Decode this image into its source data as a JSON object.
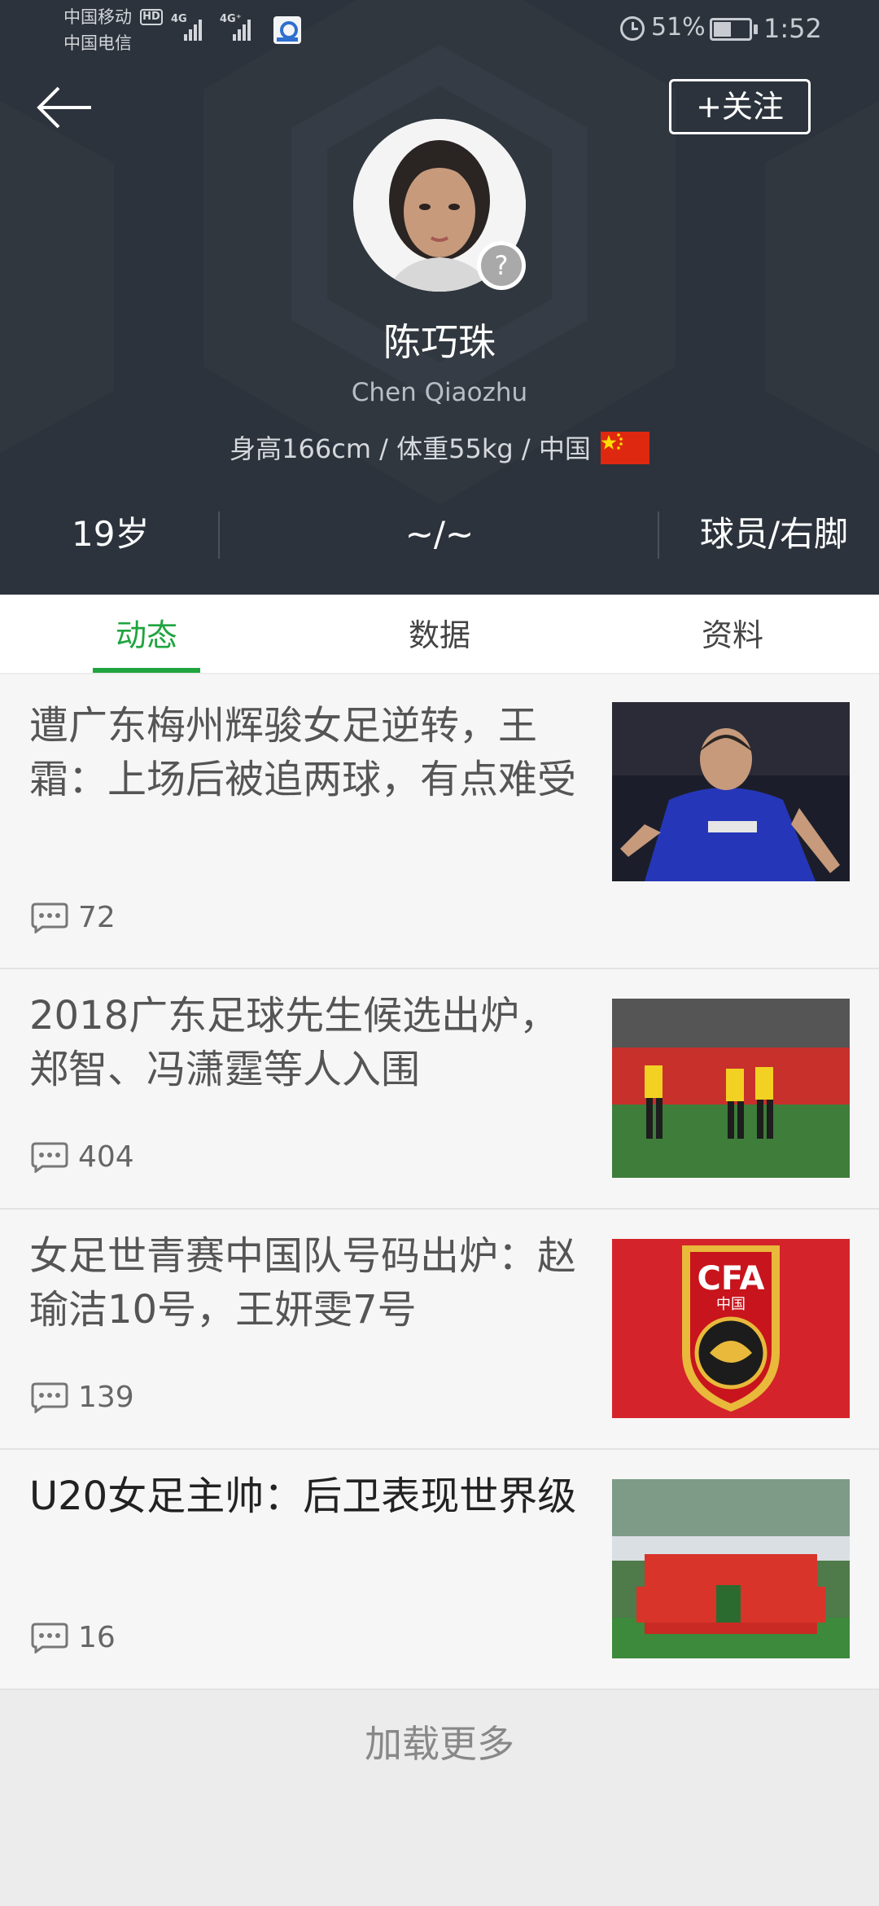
{
  "status_bar": {
    "carrier_1": "中国移动",
    "carrier_2": "中国电信",
    "hd_badge": "HD",
    "signal_1_label": "4G",
    "signal_2_label": "4G⁺",
    "battery_percent": "51%",
    "battery_level": 0.51,
    "time": "1:52"
  },
  "header": {
    "follow_label": "+关注",
    "unknown_badge": "?",
    "player_name": "陈巧珠",
    "player_name_en": "Chen Qiaozhu",
    "player_info": "身高166cm / 体重55kg / 中国",
    "flag_icon": "china-flag-icon",
    "stats": {
      "age": "19岁",
      "mid": "~/~",
      "role": "球员/右脚"
    },
    "colors": {
      "background": "#2c333c"
    }
  },
  "tabs": [
    {
      "label": "动态",
      "active": true
    },
    {
      "label": "数据",
      "active": false
    },
    {
      "label": "资料",
      "active": false
    }
  ],
  "accent_color": "#20a43f",
  "news": [
    {
      "title": "遭广东梅州辉骏女足逆转，王霜：上场后被追两球，有点难受",
      "comments": "72",
      "thumb": "blue-jersey-player-photo"
    },
    {
      "title": "2018广东足球先生候选出炉，郑智、冯潇霆等人入围",
      "comments": "404",
      "thumb": "yellow-jersey-celebration-photo"
    },
    {
      "title": "女足世青赛中国队号码出炉：赵瑜洁10号，王妍雯7号",
      "comments": "139",
      "thumb": "cfa-crest-photo",
      "thumb_text": "CFA",
      "thumb_subtext": "中国"
    },
    {
      "title": "U20女足主帅：后卫表现世界级",
      "comments": "16",
      "thumb": "team-photo"
    }
  ],
  "load_more": "加载更多"
}
